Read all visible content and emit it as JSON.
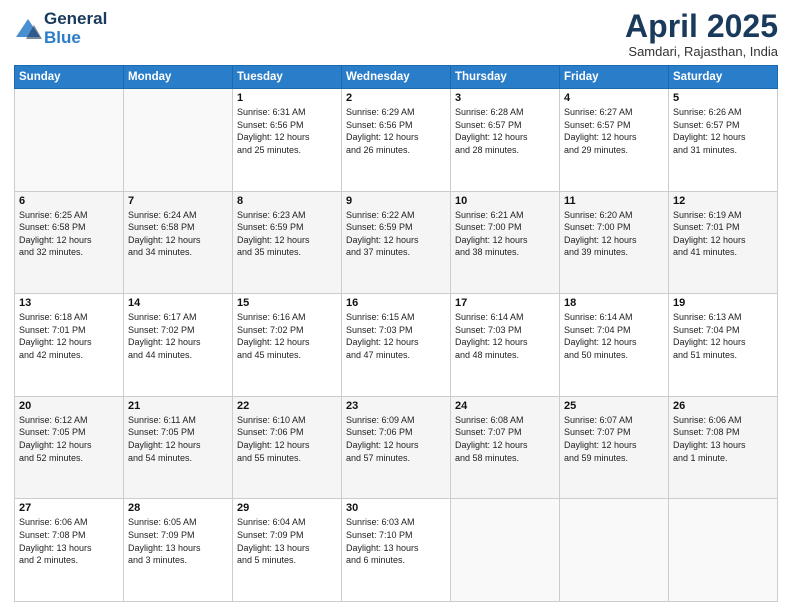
{
  "header": {
    "logo_general": "General",
    "logo_blue": "Blue",
    "month": "April 2025",
    "location": "Samdari, Rajasthan, India"
  },
  "days_of_week": [
    "Sunday",
    "Monday",
    "Tuesday",
    "Wednesday",
    "Thursday",
    "Friday",
    "Saturday"
  ],
  "weeks": [
    [
      {
        "day": "",
        "detail": ""
      },
      {
        "day": "",
        "detail": ""
      },
      {
        "day": "1",
        "detail": "Sunrise: 6:31 AM\nSunset: 6:56 PM\nDaylight: 12 hours\nand 25 minutes."
      },
      {
        "day": "2",
        "detail": "Sunrise: 6:29 AM\nSunset: 6:56 PM\nDaylight: 12 hours\nand 26 minutes."
      },
      {
        "day": "3",
        "detail": "Sunrise: 6:28 AM\nSunset: 6:57 PM\nDaylight: 12 hours\nand 28 minutes."
      },
      {
        "day": "4",
        "detail": "Sunrise: 6:27 AM\nSunset: 6:57 PM\nDaylight: 12 hours\nand 29 minutes."
      },
      {
        "day": "5",
        "detail": "Sunrise: 6:26 AM\nSunset: 6:57 PM\nDaylight: 12 hours\nand 31 minutes."
      }
    ],
    [
      {
        "day": "6",
        "detail": "Sunrise: 6:25 AM\nSunset: 6:58 PM\nDaylight: 12 hours\nand 32 minutes."
      },
      {
        "day": "7",
        "detail": "Sunrise: 6:24 AM\nSunset: 6:58 PM\nDaylight: 12 hours\nand 34 minutes."
      },
      {
        "day": "8",
        "detail": "Sunrise: 6:23 AM\nSunset: 6:59 PM\nDaylight: 12 hours\nand 35 minutes."
      },
      {
        "day": "9",
        "detail": "Sunrise: 6:22 AM\nSunset: 6:59 PM\nDaylight: 12 hours\nand 37 minutes."
      },
      {
        "day": "10",
        "detail": "Sunrise: 6:21 AM\nSunset: 7:00 PM\nDaylight: 12 hours\nand 38 minutes."
      },
      {
        "day": "11",
        "detail": "Sunrise: 6:20 AM\nSunset: 7:00 PM\nDaylight: 12 hours\nand 39 minutes."
      },
      {
        "day": "12",
        "detail": "Sunrise: 6:19 AM\nSunset: 7:01 PM\nDaylight: 12 hours\nand 41 minutes."
      }
    ],
    [
      {
        "day": "13",
        "detail": "Sunrise: 6:18 AM\nSunset: 7:01 PM\nDaylight: 12 hours\nand 42 minutes."
      },
      {
        "day": "14",
        "detail": "Sunrise: 6:17 AM\nSunset: 7:02 PM\nDaylight: 12 hours\nand 44 minutes."
      },
      {
        "day": "15",
        "detail": "Sunrise: 6:16 AM\nSunset: 7:02 PM\nDaylight: 12 hours\nand 45 minutes."
      },
      {
        "day": "16",
        "detail": "Sunrise: 6:15 AM\nSunset: 7:03 PM\nDaylight: 12 hours\nand 47 minutes."
      },
      {
        "day": "17",
        "detail": "Sunrise: 6:14 AM\nSunset: 7:03 PM\nDaylight: 12 hours\nand 48 minutes."
      },
      {
        "day": "18",
        "detail": "Sunrise: 6:14 AM\nSunset: 7:04 PM\nDaylight: 12 hours\nand 50 minutes."
      },
      {
        "day": "19",
        "detail": "Sunrise: 6:13 AM\nSunset: 7:04 PM\nDaylight: 12 hours\nand 51 minutes."
      }
    ],
    [
      {
        "day": "20",
        "detail": "Sunrise: 6:12 AM\nSunset: 7:05 PM\nDaylight: 12 hours\nand 52 minutes."
      },
      {
        "day": "21",
        "detail": "Sunrise: 6:11 AM\nSunset: 7:05 PM\nDaylight: 12 hours\nand 54 minutes."
      },
      {
        "day": "22",
        "detail": "Sunrise: 6:10 AM\nSunset: 7:06 PM\nDaylight: 12 hours\nand 55 minutes."
      },
      {
        "day": "23",
        "detail": "Sunrise: 6:09 AM\nSunset: 7:06 PM\nDaylight: 12 hours\nand 57 minutes."
      },
      {
        "day": "24",
        "detail": "Sunrise: 6:08 AM\nSunset: 7:07 PM\nDaylight: 12 hours\nand 58 minutes."
      },
      {
        "day": "25",
        "detail": "Sunrise: 6:07 AM\nSunset: 7:07 PM\nDaylight: 12 hours\nand 59 minutes."
      },
      {
        "day": "26",
        "detail": "Sunrise: 6:06 AM\nSunset: 7:08 PM\nDaylight: 13 hours\nand 1 minute."
      }
    ],
    [
      {
        "day": "27",
        "detail": "Sunrise: 6:06 AM\nSunset: 7:08 PM\nDaylight: 13 hours\nand 2 minutes."
      },
      {
        "day": "28",
        "detail": "Sunrise: 6:05 AM\nSunset: 7:09 PM\nDaylight: 13 hours\nand 3 minutes."
      },
      {
        "day": "29",
        "detail": "Sunrise: 6:04 AM\nSunset: 7:09 PM\nDaylight: 13 hours\nand 5 minutes."
      },
      {
        "day": "30",
        "detail": "Sunrise: 6:03 AM\nSunset: 7:10 PM\nDaylight: 13 hours\nand 6 minutes."
      },
      {
        "day": "",
        "detail": ""
      },
      {
        "day": "",
        "detail": ""
      },
      {
        "day": "",
        "detail": ""
      }
    ]
  ]
}
